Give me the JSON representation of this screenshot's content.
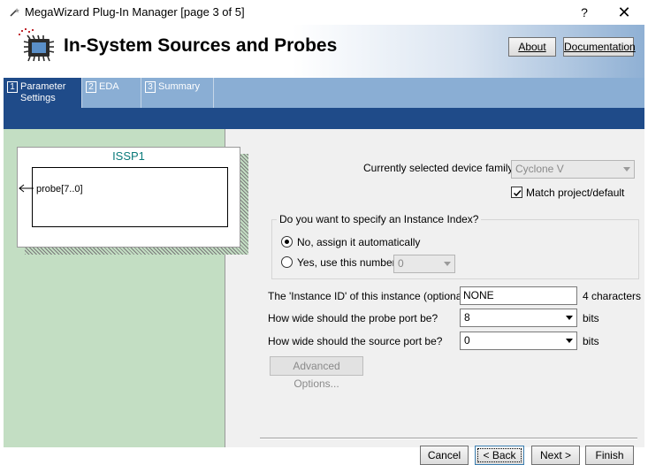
{
  "window": {
    "title": "MegaWizard Plug-In Manager [page 3 of 5]",
    "help_label": "?",
    "close_label": "✕",
    "icon": "wand-icon"
  },
  "header": {
    "title": "In-System Sources and Probes",
    "about_label": "About",
    "documentation_label": "Documentation",
    "logo_icon": "chip-icon"
  },
  "tabs": [
    {
      "num": "1",
      "label_line1": "Parameter",
      "label_line2": "Settings",
      "active": true
    },
    {
      "num": "2",
      "label_line1": "EDA",
      "label_line2": "",
      "active": false
    },
    {
      "num": "3",
      "label_line1": "Summary",
      "label_line2": "",
      "active": false
    }
  ],
  "symbol": {
    "name": "ISSP1",
    "port": "probe[7..0]"
  },
  "device": {
    "label": "Currently selected device family:",
    "value": "Cyclone V",
    "match_label": "Match project/default",
    "match_checked": true
  },
  "instance_index": {
    "question": "Do you want to specify an Instance Index?",
    "option_auto": "No, assign it automatically",
    "option_manual": "Yes, use this number",
    "manual_value": "0"
  },
  "instance_id": {
    "label": "The 'Instance ID' of this instance (optional):",
    "value": "NONE",
    "hint": "4 characters"
  },
  "probe_width": {
    "label": "How wide should the probe port be?",
    "value": "8",
    "unit": "bits"
  },
  "source_width": {
    "label": "How wide should the source port be?",
    "value": "0",
    "unit": "bits"
  },
  "advanced_label": "Advanced Options...",
  "footer": {
    "cancel": "Cancel",
    "back": "< Back",
    "next": "Next >",
    "finish": "Finish"
  },
  "colors": {
    "accent": "#1f4b89",
    "tabstrip": "#8aaed4",
    "preview_bg": "#c3dec3",
    "symbol_title": "#0a7a7a"
  }
}
